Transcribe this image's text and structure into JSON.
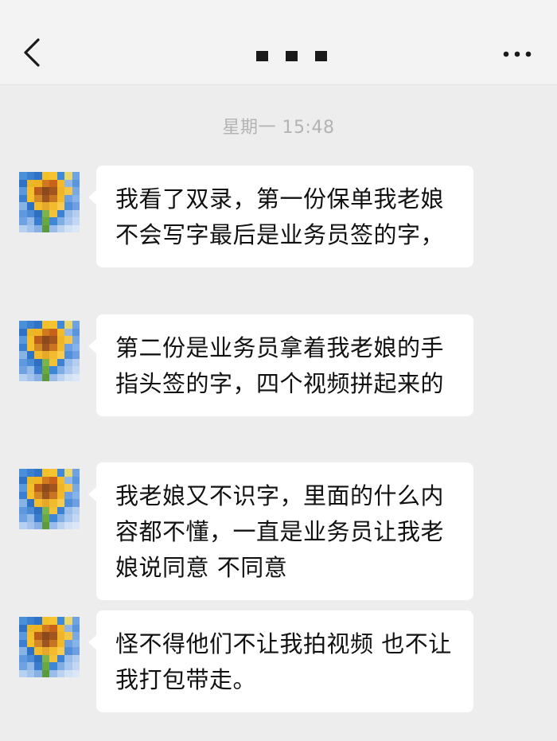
{
  "header": {
    "title_redacted": "■ ■ ■"
  },
  "timestamp": "星期一 15:48",
  "messages": [
    {
      "text": "我看了双录，第一份保单我老娘不会写字最后是业务员签的字，"
    },
    {
      "text": "第二份是业务员拿着我老娘的手指头签的字，四个视频拼起来的"
    },
    {
      "text": "我老娘又不识字，里面的什么内容都不懂，一直是业务员让我老娘说同意 不同意"
    },
    {
      "text": "怪不得他们不让我拍视频 也不让我打包带走。"
    }
  ],
  "icons": {
    "back": "chevron-left-icon",
    "more": "more-dots-icon",
    "avatar": "pixelated-sunflower-avatar"
  },
  "colors": {
    "background": "#ededed",
    "bubble": "#ffffff",
    "timestamp": "#b3b3b3"
  }
}
